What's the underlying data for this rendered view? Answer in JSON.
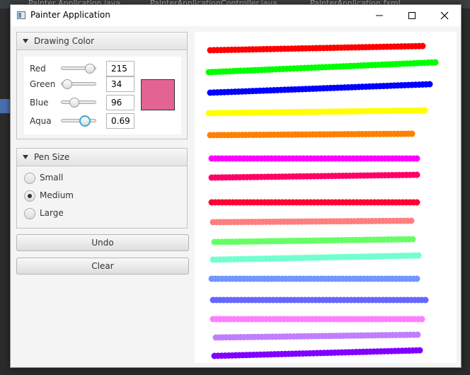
{
  "background": {
    "tabs": [
      "Painter Application.java",
      "PainterApplicationController.java",
      "PainterApplication.fxml"
    ]
  },
  "window": {
    "title": "Painter Application",
    "minimize_icon": "minimize-icon",
    "maximize_icon": "maximize-icon",
    "close_icon": "close-icon"
  },
  "drawing_color": {
    "title": "Drawing Color",
    "rows": [
      {
        "label": "Red",
        "value": "215",
        "level": 0.843
      },
      {
        "label": "Green",
        "value": "34",
        "level": 0.133
      },
      {
        "label": "Blue",
        "value": "96",
        "level": 0.376
      },
      {
        "label": "Aqua",
        "value": "0.69",
        "level": 0.69
      }
    ],
    "swatch_color": "#e36391"
  },
  "pen_size": {
    "title": "Pen Size",
    "options": [
      {
        "label": "Small",
        "selected": false
      },
      {
        "label": "Medium",
        "selected": true
      },
      {
        "label": "Large",
        "selected": false
      }
    ]
  },
  "buttons": {
    "undo": "Undo",
    "clear": "Clear"
  },
  "strokes": [
    {
      "color": "#ff0000",
      "opacity": 1.0
    },
    {
      "color": "#00ff00",
      "opacity": 1.0
    },
    {
      "color": "#0000ff",
      "opacity": 1.0
    },
    {
      "color": "#ffff00",
      "opacity": 1.0
    },
    {
      "color": "#ff8000",
      "opacity": 1.0
    },
    {
      "color": "#ff00ff",
      "opacity": 1.0
    },
    {
      "color": "#ff0066",
      "opacity": 1.0
    },
    {
      "color": "#ff0033",
      "opacity": 1.0
    },
    {
      "color": "#ff0000",
      "opacity": 0.5
    },
    {
      "color": "#00ff00",
      "opacity": 0.6
    },
    {
      "color": "#00ffaa",
      "opacity": 0.55
    },
    {
      "color": "#0040ff",
      "opacity": 0.55
    },
    {
      "color": "#0000ff",
      "opacity": 0.6
    },
    {
      "color": "#ff00ff",
      "opacity": 0.5
    },
    {
      "color": "#8000ff",
      "opacity": 0.5
    },
    {
      "color": "#8000ff",
      "opacity": 1.0
    }
  ]
}
